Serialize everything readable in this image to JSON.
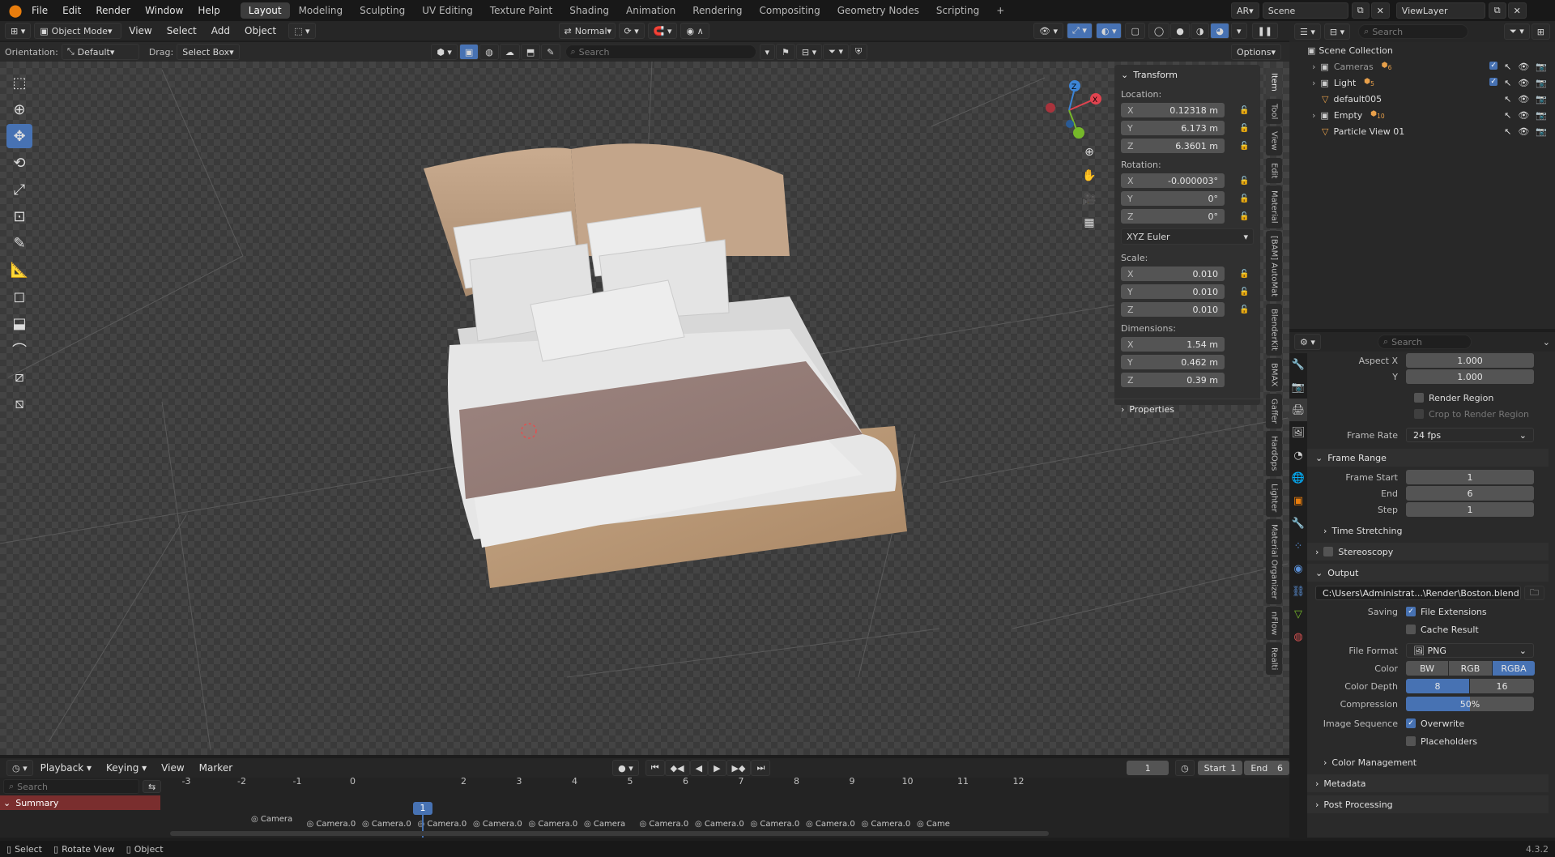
{
  "menu": [
    "File",
    "Edit",
    "Render",
    "Window",
    "Help"
  ],
  "workspaces": [
    "Layout",
    "Modeling",
    "Sculpting",
    "UV Editing",
    "Texture Paint",
    "Shading",
    "Animation",
    "Rendering",
    "Compositing",
    "Geometry Nodes",
    "Scripting"
  ],
  "active_workspace": "Layout",
  "topright": {
    "ar": "AR",
    "scene": "Scene",
    "view_layer": "ViewLayer"
  },
  "viewport_header": {
    "mode": "Object Mode",
    "menus": [
      "View",
      "Select",
      "Add",
      "Object"
    ],
    "shading_mode": "Normal",
    "orientation_label": "Orientation:",
    "orientation": "Default",
    "drag_label": "Drag:",
    "drag": "Select Box",
    "search_placeholder": "Search",
    "options": "Options"
  },
  "transform": {
    "title": "Transform",
    "location_label": "Location:",
    "location": [
      [
        "X",
        "0.12318 m"
      ],
      [
        "Y",
        "6.173 m"
      ],
      [
        "Z",
        "6.3601 m"
      ]
    ],
    "rotation_label": "Rotation:",
    "rotation": [
      [
        "X",
        "-0.000003°"
      ],
      [
        "Y",
        "0°"
      ],
      [
        "Z",
        "0°"
      ]
    ],
    "rotation_mode": "XYZ Euler",
    "scale_label": "Scale:",
    "scale": [
      [
        "X",
        "0.010"
      ],
      [
        "Y",
        "0.010"
      ],
      [
        "Z",
        "0.010"
      ]
    ],
    "dimensions_label": "Dimensions:",
    "dimensions": [
      [
        "X",
        "1.54 m"
      ],
      [
        "Y",
        "0.462 m"
      ],
      [
        "Z",
        "0.39 m"
      ]
    ],
    "properties": "Properties"
  },
  "side_tabs": [
    "Item",
    "Tool",
    "View",
    "Edit",
    "Material",
    "[BAM] AutoMat",
    "BlenderKit",
    "BMAX",
    "Gaffer",
    "HardOps",
    "Lighter",
    "Material Organizer",
    "nFlow",
    "Realti"
  ],
  "outliner": {
    "search_placeholder": "Search",
    "collection": "Scene Collection",
    "items": [
      {
        "name": "Cameras",
        "badge": "6"
      },
      {
        "name": "Light",
        "badge": "5"
      },
      {
        "name": "default005",
        "badge": ""
      },
      {
        "name": "Empty",
        "badge": "10"
      },
      {
        "name": "Particle View 01",
        "badge": ""
      }
    ]
  },
  "properties": {
    "search_placeholder": "Search",
    "aspect_x_label": "Aspect X",
    "aspect_x": "1.000",
    "aspect_y_label": "Y",
    "aspect_y": "1.000",
    "render_region": "Render Region",
    "crop_region": "Crop to Render Region",
    "frame_rate_label": "Frame Rate",
    "frame_rate": "24 fps",
    "frame_range": "Frame Range",
    "frame_start_label": "Frame Start",
    "frame_start": "1",
    "end_label": "End",
    "end": "6",
    "step_label": "Step",
    "step": "1",
    "time_stretching": "Time Stretching",
    "stereoscopy": "Stereoscopy",
    "output": "Output",
    "output_path": "C:\\Users\\Administrat...\\Render\\Boston.blend",
    "saving_label": "Saving",
    "file_extensions": "File Extensions",
    "cache_result": "Cache Result",
    "file_format_label": "File Format",
    "file_format": "PNG",
    "color_label": "Color",
    "color_opts": [
      "BW",
      "RGB",
      "RGBA"
    ],
    "depth_label": "Color Depth",
    "depth_opts": [
      "8",
      "16"
    ],
    "compression_label": "Compression",
    "compression": "50%",
    "compression_value": 0.5,
    "image_seq_label": "Image Sequence",
    "overwrite": "Overwrite",
    "placeholders": "Placeholders",
    "color_management": "Color Management",
    "metadata": "Metadata",
    "post_processing": "Post Processing"
  },
  "timeline": {
    "menus": [
      "Playback",
      "Keying",
      "View",
      "Marker"
    ],
    "current_frame": "1",
    "start_label": "Start",
    "start": "1",
    "end_label": "End",
    "end": "6",
    "search_placeholder": "Search",
    "summary": "Summary",
    "ticks": [
      "-3",
      "-2",
      "-1",
      "0",
      "1",
      "2",
      "3",
      "4",
      "5",
      "6",
      "7",
      "8",
      "9",
      "10",
      "11",
      "12"
    ],
    "markers": [
      "Camera",
      "Camera.0",
      "Camera.0",
      "Camera.0",
      "Camera.0",
      "Camera.0",
      "Camera",
      "Camera.0",
      "Camera.0",
      "Camera.0",
      "Camera.0",
      "Camera.0",
      "Came"
    ]
  },
  "status": {
    "select": "Select",
    "rotate": "Rotate View",
    "object": "Object",
    "version": "4.3.2"
  },
  "colors": {
    "accent": "#4772b3",
    "x_axis": "#e0434f",
    "y_axis": "#76b82a",
    "z_axis": "#3c84d6"
  }
}
